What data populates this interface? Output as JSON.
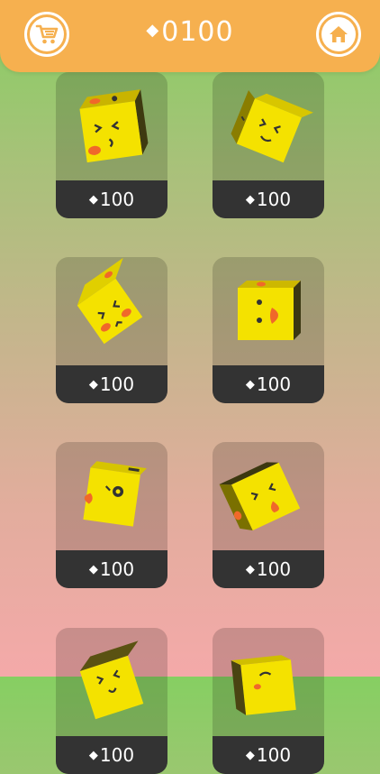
{
  "header": {
    "diamond_icon": "diamond-icon",
    "balance": "0100",
    "cart_icon": "cart-icon",
    "home_icon": "home-icon"
  },
  "colors": {
    "header_bg": "#f6b04f",
    "cube_yellow": "#f4e200",
    "cheek_orange": "#f0682a",
    "price_bar_bg": "#333333"
  },
  "shop": {
    "items": [
      {
        "price": "100",
        "diamond": "◆"
      },
      {
        "price": "100",
        "diamond": "◆"
      },
      {
        "price": "100",
        "diamond": "◆"
      },
      {
        "price": "100",
        "diamond": "◆"
      },
      {
        "price": "100",
        "diamond": "◆"
      },
      {
        "price": "100",
        "diamond": "◆"
      },
      {
        "price": "100",
        "diamond": "◆"
      },
      {
        "price": "100",
        "diamond": "◆"
      }
    ]
  }
}
